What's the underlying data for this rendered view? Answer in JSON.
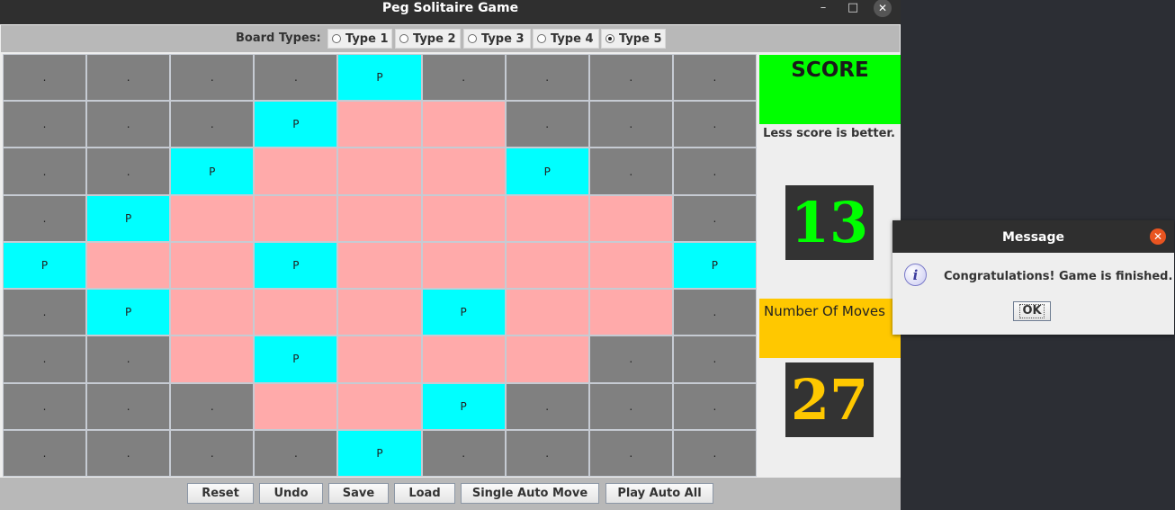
{
  "window": {
    "title": "Peg Solitaire Game",
    "min_icon": "minimize-icon",
    "max_icon": "maximize-icon",
    "close_icon": "close-icon"
  },
  "board_types": {
    "label": "Board Types:",
    "options": [
      "Type 1",
      "Type 2",
      "Type 3",
      "Type 4",
      "Type 5"
    ],
    "selected": "Type 5"
  },
  "board": {
    "rows": [
      [
        ".",
        ".",
        ".",
        ".",
        "P",
        ".",
        ".",
        ".",
        "."
      ],
      [
        ".",
        ".",
        ".",
        "P",
        "",
        "",
        ".",
        ".",
        "."
      ],
      [
        ".",
        ".",
        "P",
        "",
        "",
        "",
        "P",
        ".",
        "."
      ],
      [
        ".",
        "P",
        "",
        "",
        "",
        "",
        "",
        "",
        "."
      ],
      [
        "P",
        "",
        "",
        "P",
        "",
        "",
        "",
        "",
        "P"
      ],
      [
        ".",
        "P",
        "",
        "",
        "",
        "P",
        "",
        "",
        "."
      ],
      [
        ".",
        ".",
        "",
        "P",
        "",
        "",
        "",
        ".",
        "."
      ],
      [
        ".",
        ".",
        ".",
        "",
        "",
        "P",
        ".",
        ".",
        "."
      ],
      [
        ".",
        ".",
        ".",
        ".",
        "P",
        ".",
        ".",
        ".",
        "."
      ]
    ],
    "colors": {
      "blocked": "#808080",
      "peg": "#00ffff",
      "empty": "#ffaaaa"
    }
  },
  "score": {
    "title": "SCORE",
    "hint": "Less score is better.",
    "value": "13",
    "color": "#00ff00"
  },
  "moves": {
    "title": "Number Of Moves",
    "value": "27",
    "color": "#ffc800"
  },
  "buttons": [
    "Reset",
    "Undo",
    "Save",
    "Load",
    "Single Auto Move",
    "Play Auto All"
  ],
  "dialog": {
    "title": "Message",
    "message": "Congratulations! Game is finished.",
    "ok": "OK",
    "icon": "info-icon",
    "close_icon": "close-icon"
  }
}
